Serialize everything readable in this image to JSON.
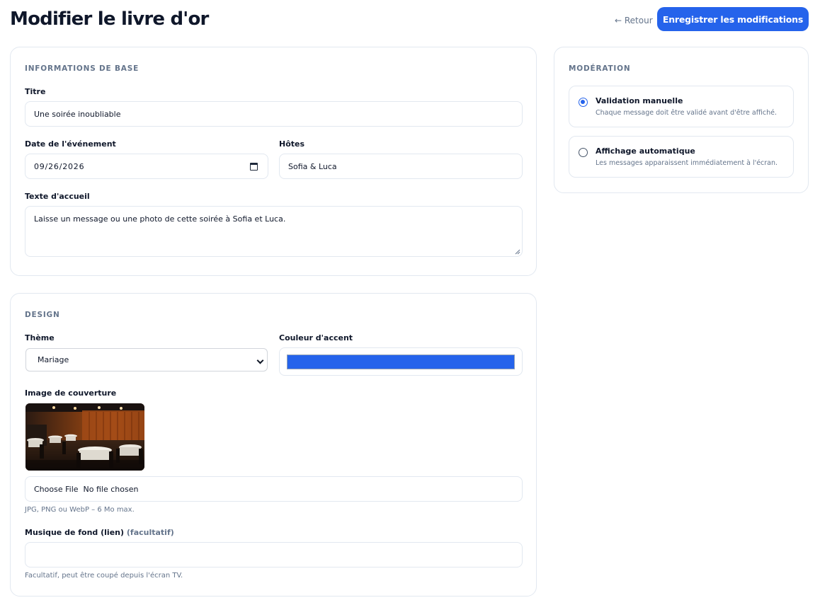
{
  "header": {
    "title": "Modifier le livre d'or",
    "back_label": "← Retour",
    "save_label": "Enregistrer les modifications"
  },
  "basic_info": {
    "section_title": "INFORMATIONS DE BASE",
    "title_label": "Titre",
    "title_value": "Une soirée inoubliable",
    "date_label": "Date de l'événement",
    "date_value": "09/26/2026",
    "hosts_label": "Hôtes",
    "hosts_value": "Sofia & Luca",
    "welcome_label": "Texte d'accueil",
    "welcome_value": "Laisse un message ou une photo de cette soirée à Sofia et Luca."
  },
  "design": {
    "section_title": "DESIGN",
    "theme_label": "Thème",
    "theme_value": "Mariage",
    "accent_label": "Couleur d'accent",
    "accent_color": "#2563eb",
    "cover_label": "Image de couverture",
    "file_input_text": "Choose File  No file chosen",
    "file_hint": "JPG, PNG ou WebP – 6 Mo max.",
    "music_label": "Musique de fond (lien)",
    "music_optional": "(facultatif)",
    "music_value": "",
    "music_hint": "Facultatif, peut être coupé depuis l'écran TV."
  },
  "moderation": {
    "section_title": "MODÉRATION",
    "options": [
      {
        "title": "Validation manuelle",
        "description": "Chaque message doit être validé avant d'être affiché.",
        "selected": true
      },
      {
        "title": "Affichage automatique",
        "description": "Les messages apparaissent immédiatement à l'écran.",
        "selected": false
      }
    ]
  },
  "colors": {
    "primary": "#2563eb",
    "text": "#0f172a",
    "muted": "#64748b",
    "border": "#e2e8f0"
  }
}
